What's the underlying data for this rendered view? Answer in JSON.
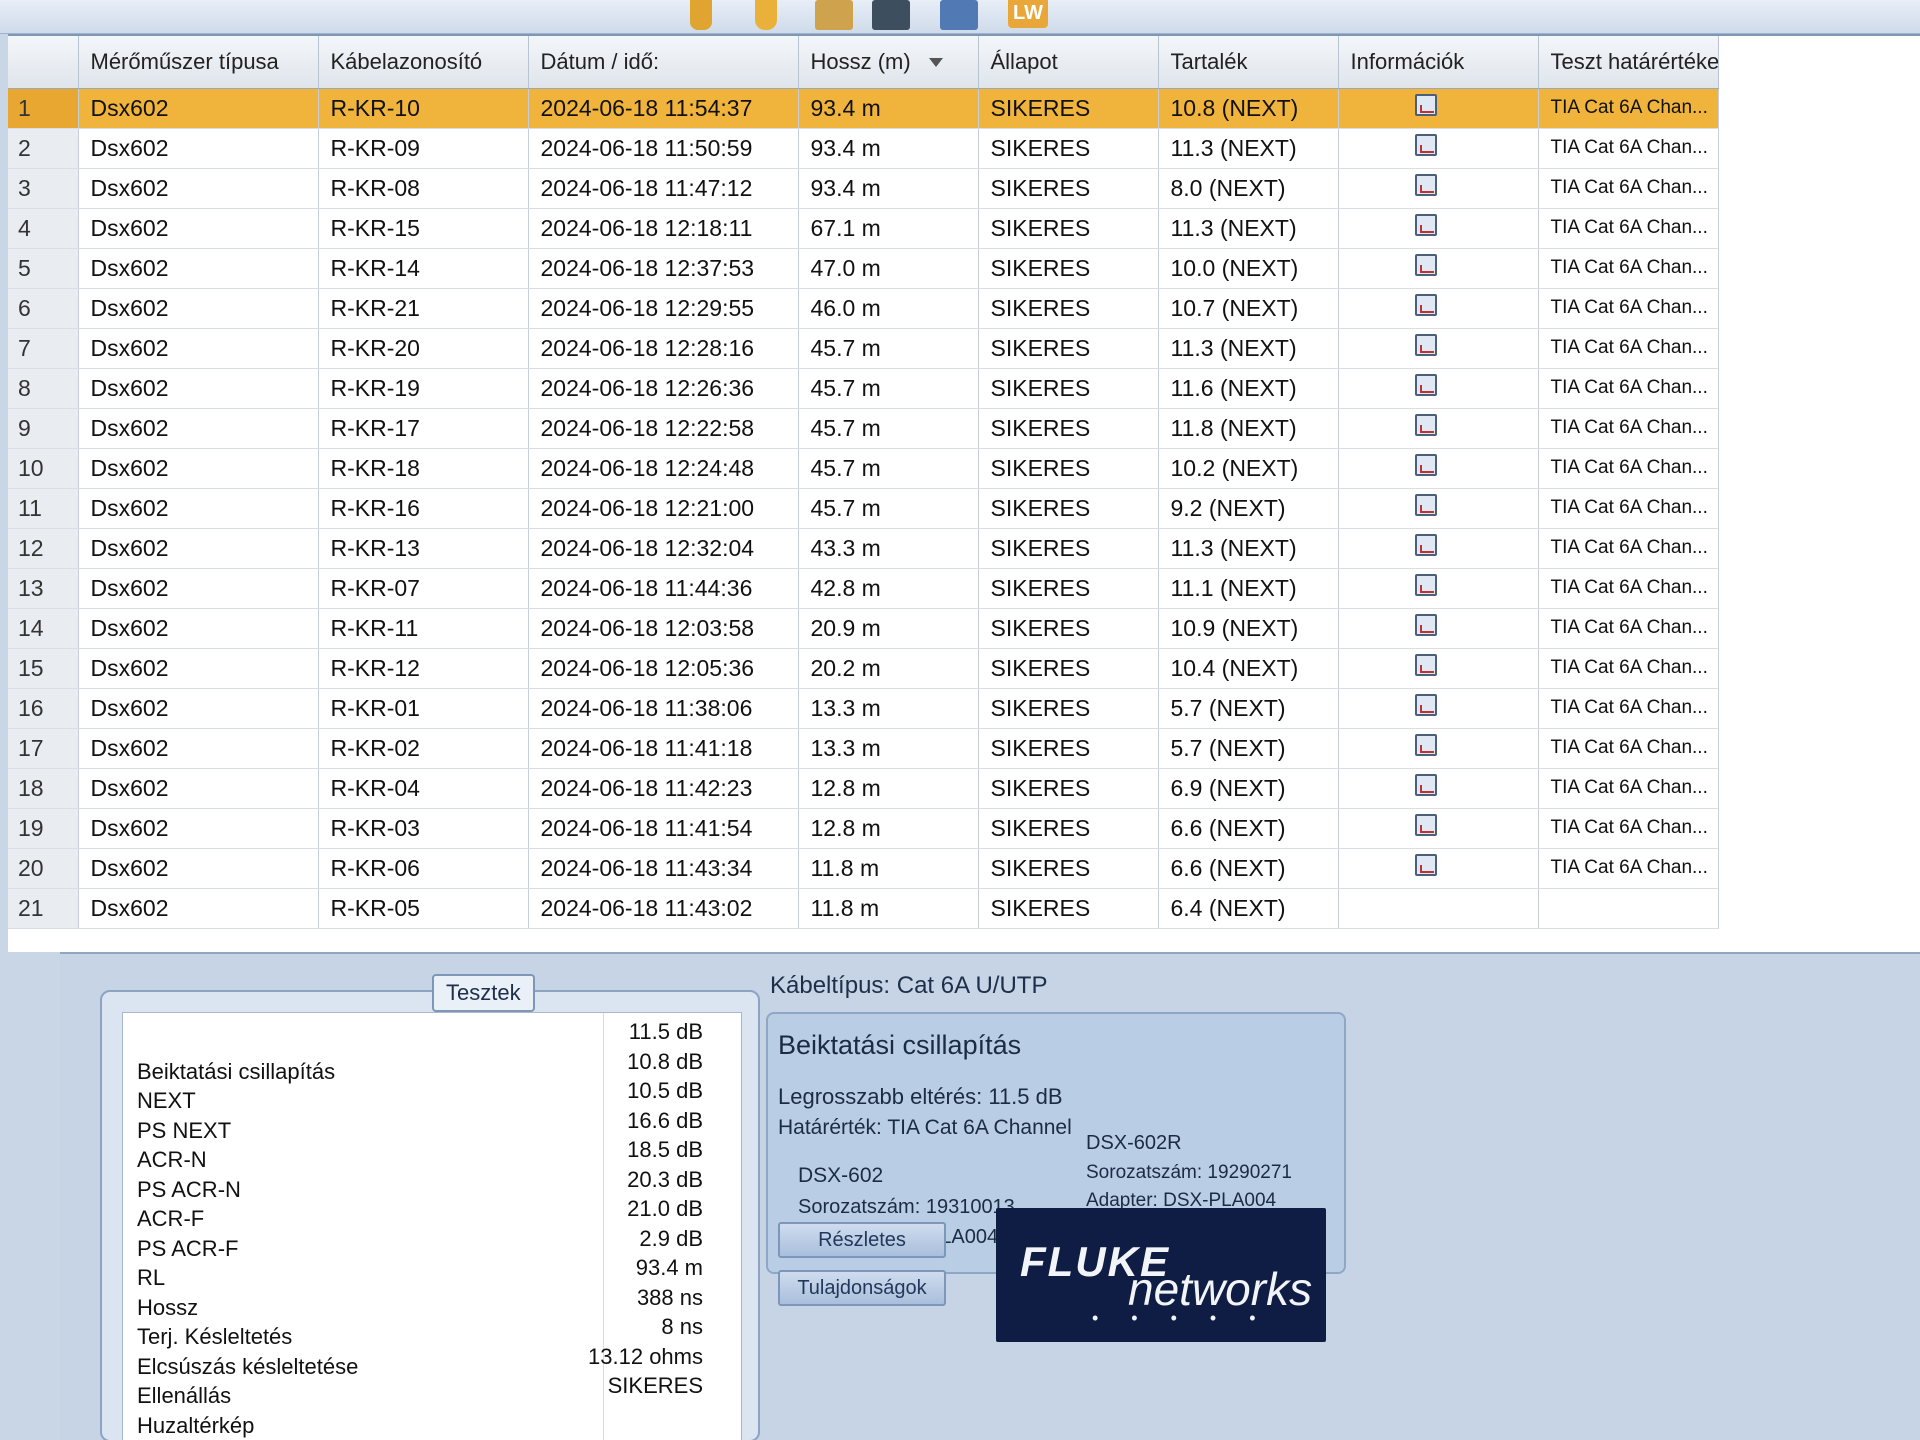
{
  "toolbar": {
    "lw_label": "LW"
  },
  "table": {
    "columns": [
      "",
      "Mérőműszer típusa",
      "Kábelazonosító",
      "Dátum / idő:",
      "Hossz (m)",
      "Állapot",
      "Tartalék",
      "Információk",
      "Teszt határértéke"
    ],
    "rows": [
      {
        "n": "1",
        "type": "Dsx602",
        "id": "R-KR-10",
        "date": "2024-06-18  11:54:37",
        "len": "93.4 m",
        "status": "SIKERES",
        "margin": "10.8 (NEXT)",
        "limit": "TIA Cat 6A Chan..."
      },
      {
        "n": "2",
        "type": "Dsx602",
        "id": "R-KR-09",
        "date": "2024-06-18  11:50:59",
        "len": "93.4 m",
        "status": "SIKERES",
        "margin": "11.3 (NEXT)",
        "limit": "TIA Cat 6A Chan..."
      },
      {
        "n": "3",
        "type": "Dsx602",
        "id": "R-KR-08",
        "date": "2024-06-18  11:47:12",
        "len": "93.4 m",
        "status": "SIKERES",
        "margin": "8.0 (NEXT)",
        "limit": "TIA Cat 6A Chan..."
      },
      {
        "n": "4",
        "type": "Dsx602",
        "id": "R-KR-15",
        "date": "2024-06-18  12:18:11",
        "len": "67.1 m",
        "status": "SIKERES",
        "margin": "11.3 (NEXT)",
        "limit": "TIA Cat 6A Chan..."
      },
      {
        "n": "5",
        "type": "Dsx602",
        "id": "R-KR-14",
        "date": "2024-06-18  12:37:53",
        "len": "47.0 m",
        "status": "SIKERES",
        "margin": "10.0 (NEXT)",
        "limit": "TIA Cat 6A Chan..."
      },
      {
        "n": "6",
        "type": "Dsx602",
        "id": "R-KR-21",
        "date": "2024-06-18  12:29:55",
        "len": "46.0 m",
        "status": "SIKERES",
        "margin": "10.7 (NEXT)",
        "limit": "TIA Cat 6A Chan..."
      },
      {
        "n": "7",
        "type": "Dsx602",
        "id": "R-KR-20",
        "date": "2024-06-18  12:28:16",
        "len": "45.7 m",
        "status": "SIKERES",
        "margin": "11.3 (NEXT)",
        "limit": "TIA Cat 6A Chan..."
      },
      {
        "n": "8",
        "type": "Dsx602",
        "id": "R-KR-19",
        "date": "2024-06-18  12:26:36",
        "len": "45.7 m",
        "status": "SIKERES",
        "margin": "11.6 (NEXT)",
        "limit": "TIA Cat 6A Chan..."
      },
      {
        "n": "9",
        "type": "Dsx602",
        "id": "R-KR-17",
        "date": "2024-06-18  12:22:58",
        "len": "45.7 m",
        "status": "SIKERES",
        "margin": "11.8 (NEXT)",
        "limit": "TIA Cat 6A Chan..."
      },
      {
        "n": "10",
        "type": "Dsx602",
        "id": "R-KR-18",
        "date": "2024-06-18  12:24:48",
        "len": "45.7 m",
        "status": "SIKERES",
        "margin": "10.2 (NEXT)",
        "limit": "TIA Cat 6A Chan..."
      },
      {
        "n": "11",
        "type": "Dsx602",
        "id": "R-KR-16",
        "date": "2024-06-18  12:21:00",
        "len": "45.7 m",
        "status": "SIKERES",
        "margin": "9.2 (NEXT)",
        "limit": "TIA Cat 6A Chan..."
      },
      {
        "n": "12",
        "type": "Dsx602",
        "id": "R-KR-13",
        "date": "2024-06-18  12:32:04",
        "len": "43.3 m",
        "status": "SIKERES",
        "margin": "11.3 (NEXT)",
        "limit": "TIA Cat 6A Chan..."
      },
      {
        "n": "13",
        "type": "Dsx602",
        "id": "R-KR-07",
        "date": "2024-06-18  11:44:36",
        "len": "42.8 m",
        "status": "SIKERES",
        "margin": "11.1 (NEXT)",
        "limit": "TIA Cat 6A Chan..."
      },
      {
        "n": "14",
        "type": "Dsx602",
        "id": "R-KR-11",
        "date": "2024-06-18  12:03:58",
        "len": "20.9 m",
        "status": "SIKERES",
        "margin": "10.9 (NEXT)",
        "limit": "TIA Cat 6A Chan..."
      },
      {
        "n": "15",
        "type": "Dsx602",
        "id": "R-KR-12",
        "date": "2024-06-18  12:05:36",
        "len": "20.2 m",
        "status": "SIKERES",
        "margin": "10.4 (NEXT)",
        "limit": "TIA Cat 6A Chan..."
      },
      {
        "n": "16",
        "type": "Dsx602",
        "id": "R-KR-01",
        "date": "2024-06-18  11:38:06",
        "len": "13.3 m",
        "status": "SIKERES",
        "margin": "5.7 (NEXT)",
        "limit": "TIA Cat 6A Chan..."
      },
      {
        "n": "17",
        "type": "Dsx602",
        "id": "R-KR-02",
        "date": "2024-06-18  11:41:18",
        "len": "13.3 m",
        "status": "SIKERES",
        "margin": "5.7 (NEXT)",
        "limit": "TIA Cat 6A Chan..."
      },
      {
        "n": "18",
        "type": "Dsx602",
        "id": "R-KR-04",
        "date": "2024-06-18  11:42:23",
        "len": "12.8 m",
        "status": "SIKERES",
        "margin": "6.9 (NEXT)",
        "limit": "TIA Cat 6A Chan..."
      },
      {
        "n": "19",
        "type": "Dsx602",
        "id": "R-KR-03",
        "date": "2024-06-18  11:41:54",
        "len": "12.8 m",
        "status": "SIKERES",
        "margin": "6.6 (NEXT)",
        "limit": "TIA Cat 6A Chan..."
      },
      {
        "n": "20",
        "type": "Dsx602",
        "id": "R-KR-06",
        "date": "2024-06-18  11:43:34",
        "len": "11.8 m",
        "status": "SIKERES",
        "margin": "6.6 (NEXT)",
        "limit": "TIA Cat 6A Chan..."
      },
      {
        "n": "21",
        "type": "Dsx602",
        "id": "R-KR-05",
        "date": "2024-06-18  11:43:02",
        "len": "11.8 m",
        "status": "SIKERES",
        "margin": "6.4 (NEXT)",
        "limit": ""
      }
    ]
  },
  "tests": {
    "tab_label": "Tesztek",
    "rows": [
      {
        "name": "",
        "value": "11.5 dB"
      },
      {
        "name": "Beiktatási csillapítás",
        "value": "10.8 dB"
      },
      {
        "name": "NEXT",
        "value": "10.5 dB"
      },
      {
        "name": "PS NEXT",
        "value": "16.6 dB"
      },
      {
        "name": "ACR-N",
        "value": "18.5 dB"
      },
      {
        "name": "PS ACR-N",
        "value": "20.3 dB"
      },
      {
        "name": "ACR-F",
        "value": "21.0 dB"
      },
      {
        "name": "PS ACR-F",
        "value": "2.9 dB"
      },
      {
        "name": "RL",
        "value": "93.4 m"
      },
      {
        "name": "Hossz",
        "value": "388 ns"
      },
      {
        "name": "Terj. Késleltetés",
        "value": "8 ns"
      },
      {
        "name": "Elcsúszás késleltetése",
        "value": "13.12 ohms"
      },
      {
        "name": "Ellenállás",
        "value": "SIKERES"
      },
      {
        "name": "Huzaltérkép",
        "value": ""
      }
    ]
  },
  "summary": {
    "cable_type": "Kábeltípus: Cat 6A U/UTP",
    "title": "Beiktatási csillapítás",
    "worst_diff": "Legrosszabb eltérés: 11.5 dB",
    "limit": "Határérték: TIA Cat 6A Channel",
    "device1": {
      "model": "DSX-602",
      "serial": "Sorozatszám: 19310013",
      "adapter": "Adapter: DSX-PLA004"
    },
    "device2": {
      "model": "DSX-602R",
      "serial": "Sorozatszám: 19290271",
      "adapter": "Adapter: DSX-PLA004"
    }
  },
  "buttons": {
    "details": "Részletes",
    "properties": "Tulajdonságok"
  },
  "logo": {
    "brand": "FLUKE",
    "sub": "networks",
    "dots": "• • • • •"
  },
  "colors": {
    "selected_row": "#f0b43c",
    "logo_bg": "#0f1d45"
  }
}
